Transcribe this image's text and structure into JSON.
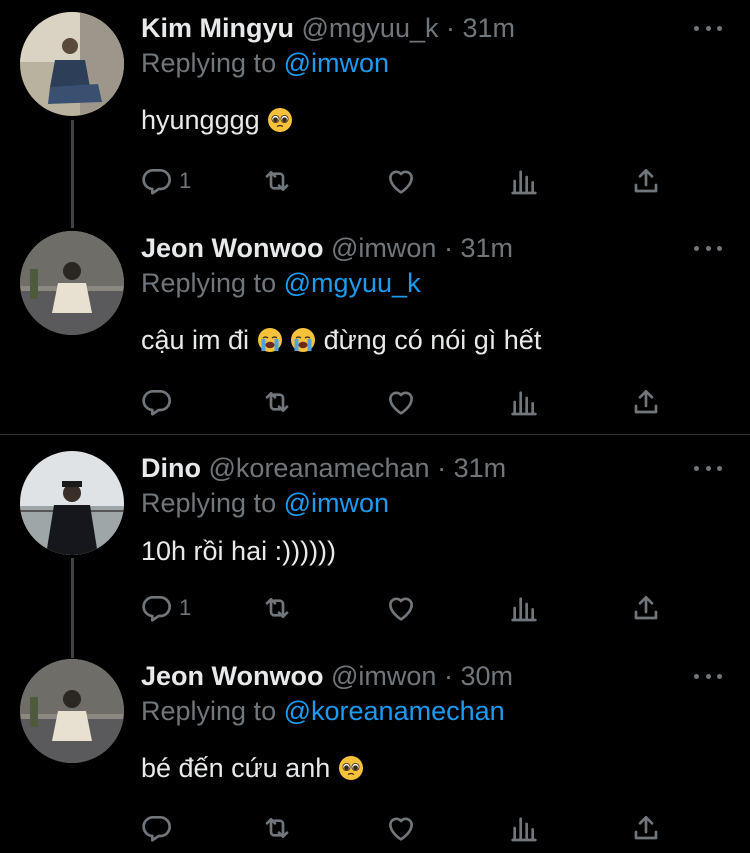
{
  "tweets": [
    {
      "name": "Kim Mingyu",
      "handle": "@mgyuu_k",
      "dot": "·",
      "time": "31m",
      "replying_label": "Replying to",
      "replying_to": "@imwon",
      "text": "hyungggg",
      "emoji": [
        "pleading-face"
      ],
      "reply_count": "1"
    },
    {
      "name": "Jeon Wonwoo",
      "handle": "@imwon",
      "dot": "·",
      "time": "31m",
      "replying_label": "Replying to",
      "replying_to": "@mgyuu_k",
      "text_part1": "cậu im đi",
      "text_part2": "đừng có nói gì hết",
      "emoji": [
        "loudly-crying-face",
        "loudly-crying-face"
      ],
      "reply_count": ""
    },
    {
      "name": "Dino",
      "handle": "@koreanamechan",
      "dot": "·",
      "time": "31m",
      "replying_label": "Replying to",
      "replying_to": "@imwon",
      "text": "10h rồi hai :))))))",
      "reply_count": "1"
    },
    {
      "name": "Jeon Wonwoo",
      "handle": "@imwon",
      "dot": "·",
      "time": "30m",
      "replying_label": "Replying to",
      "replying_to": "@koreanamechan",
      "text": "bé đến cứu anh",
      "emoji": [
        "pleading-face"
      ],
      "reply_count": ""
    }
  ],
  "icons": [
    "reply-icon",
    "retweet-icon",
    "like-icon",
    "analytics-icon",
    "share-icon",
    "more-icon"
  ],
  "colors": {
    "background": "#000000",
    "primary_text": "#e7e9ea",
    "secondary_text": "#71767b",
    "link": "#1d9bf0",
    "emoji": "#f7c23b"
  }
}
